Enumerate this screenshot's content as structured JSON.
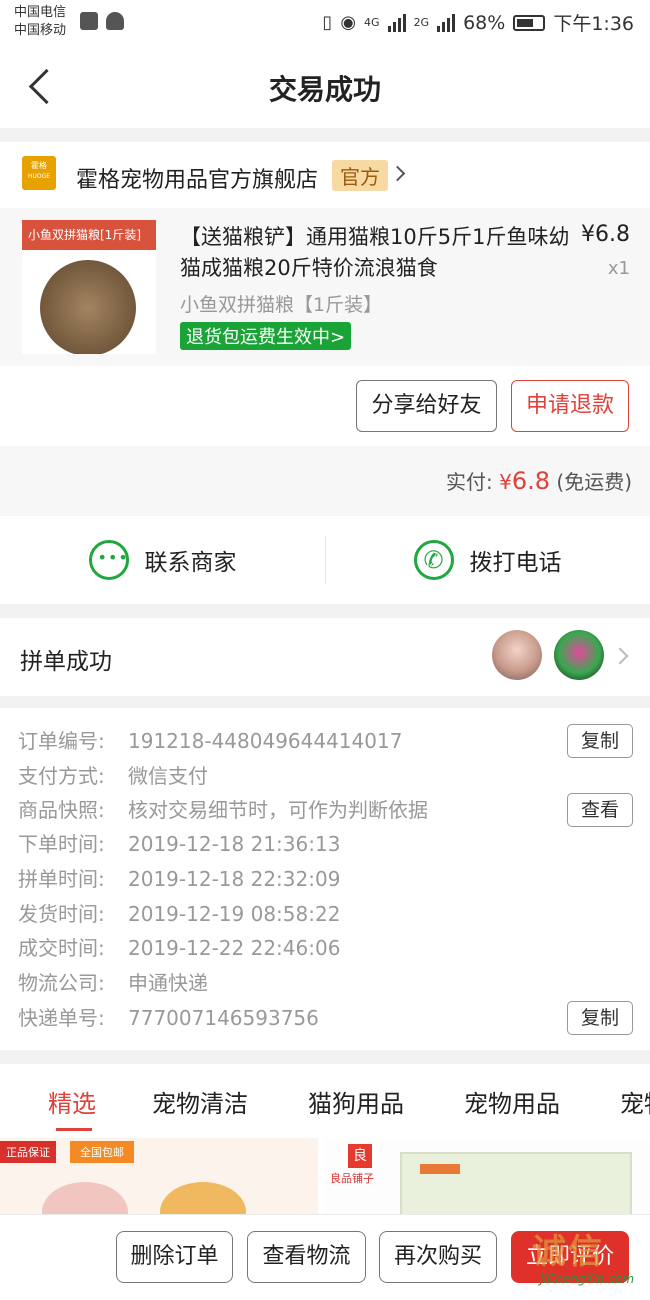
{
  "status_bar": {
    "carrier1": "中国电信",
    "carrier2": "中国移动",
    "net1": "4G",
    "net2": "2G",
    "battery": "68%",
    "time": "下午1:36"
  },
  "nav": {
    "title": "交易成功"
  },
  "store": {
    "logo_text": "霍格",
    "logo_sub": "HUOGE",
    "name": "霍格宠物用品官方旗舰店",
    "badge": "官方"
  },
  "product": {
    "image_tag": "小鱼双拼猫粮[1斤装]",
    "title": "【送猫粮铲】通用猫粮10斤5斤1斤鱼味幼猫成猫粮20斤特价流浪猫食",
    "price": "¥6.8",
    "quantity": "x1",
    "spec": "小鱼双拼猫粮【1斤装】",
    "tag": "退货包运费生效中>"
  },
  "actions": {
    "share": "分享给好友",
    "refund": "申请退款"
  },
  "total": {
    "label": "实付:",
    "currency": "¥",
    "amount": "6.8",
    "note": "(免运费)"
  },
  "contact": {
    "merchant": "联系商家",
    "phone": "拨打电话"
  },
  "group": {
    "label": "拼单成功"
  },
  "details": {
    "rows": [
      {
        "key": "订单编号:",
        "value": "191218-448049644414017",
        "button": "复制"
      },
      {
        "key": "支付方式:",
        "value": "微信支付"
      },
      {
        "key": "商品快照:",
        "value": "核对交易细节时，可作为判断依据",
        "button": "查看"
      },
      {
        "key": "下单时间:",
        "value": "2019-12-18 21:36:13"
      },
      {
        "key": "拼单时间:",
        "value": "2019-12-18 22:32:09"
      },
      {
        "key": "发货时间:",
        "value": "2019-12-19 08:58:22"
      },
      {
        "key": "成交时间:",
        "value": "2019-12-22 22:46:06"
      },
      {
        "key": "物流公司:",
        "value": "申通快递"
      },
      {
        "key": "快递单号:",
        "value": "777007146593756",
        "button": "复制"
      }
    ]
  },
  "tabs": [
    "精选",
    "宠物清洁",
    "猫狗用品",
    "宠物用品",
    "宠物"
  ],
  "cards": {
    "tag_genuine": "正品保证",
    "tag_shipping": "全国包邮",
    "brand_mark": "良",
    "brand_name": "良品铺子"
  },
  "bottom_bar": {
    "delete": "删除订单",
    "logistics": "查看物流",
    "rebuy": "再次购买",
    "review": "立即评价"
  },
  "watermark": {
    "logo": "诚信",
    "url": "JiChengXin.com"
  },
  "colors": {
    "accent": "#e0413a",
    "green": "#1aa336",
    "badge_bg": "#f6d9a3"
  }
}
